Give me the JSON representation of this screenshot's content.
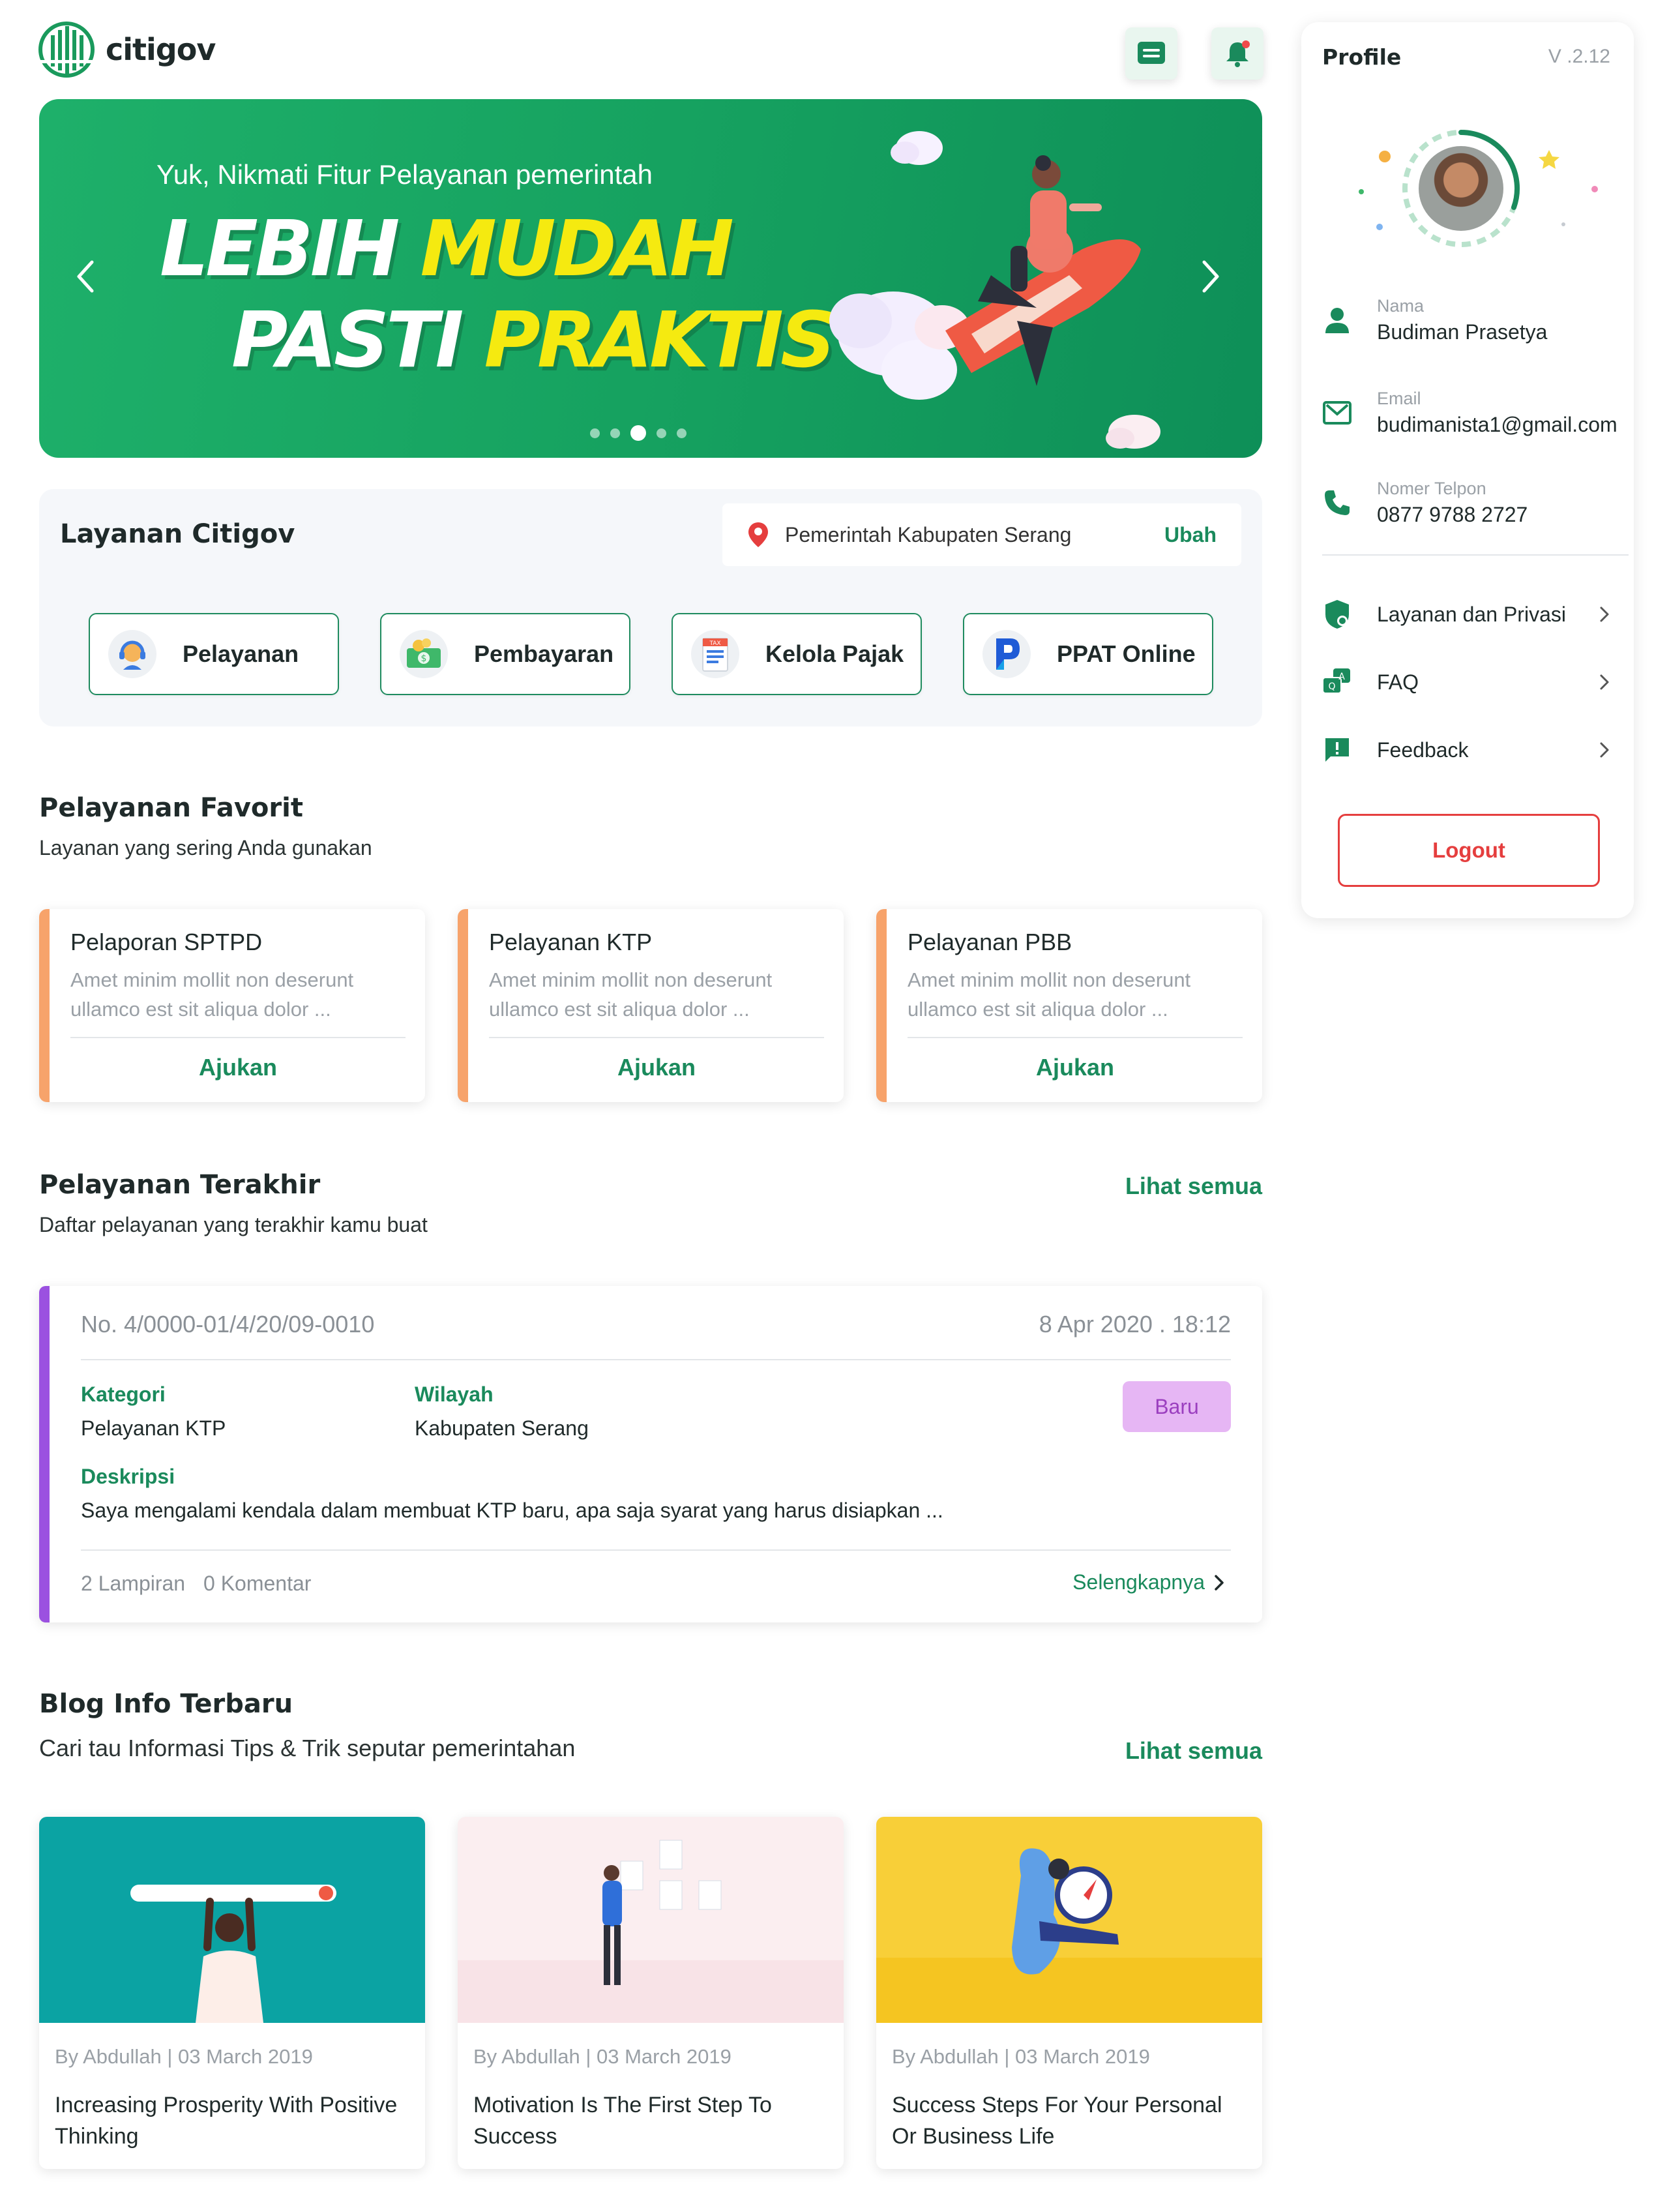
{
  "brand": {
    "name": "citigov",
    "primary": "#1a8a5c",
    "accent": "#f5ea10"
  },
  "header": {
    "message_icon": "message-icon",
    "notification_icon": "bell-icon"
  },
  "banner": {
    "subtitle": "Yuk, Nikmati Fitur Pelayanan pemerintah",
    "line1_white": "LEBIH ",
    "line1_yellow": "MUDAH",
    "line2_white": "PASTI ",
    "line2_yellow": "PRAKTIS",
    "slide_count": 5,
    "active_slide": 3
  },
  "layanan": {
    "title": "Layanan Citigov",
    "location": "Pemerintah Kabupaten Serang",
    "change_label": "Ubah",
    "services": [
      {
        "label": "Pelayanan",
        "icon": "support-agent-icon"
      },
      {
        "label": "Pembayaran",
        "icon": "money-icon"
      },
      {
        "label": "Kelola Pajak",
        "icon": "tax-icon"
      },
      {
        "label": "PPAT Online",
        "icon": "ppat-logo-icon"
      }
    ]
  },
  "favorit": {
    "title": "Pelayanan Favorit",
    "subtitle": "Layanan yang sering Anda gunakan",
    "cards": [
      {
        "title": "Pelaporan SPTPD",
        "desc": "Amet minim mollit non deserunt ullamco est sit aliqua dolor ...",
        "action": "Ajukan"
      },
      {
        "title": "Pelayanan KTP",
        "desc": "Amet minim mollit non deserunt ullamco est sit aliqua dolor ...",
        "action": "Ajukan"
      },
      {
        "title": "Pelayanan PBB",
        "desc": "Amet minim mollit non deserunt ullamco est sit aliqua dolor ...",
        "action": "Ajukan"
      }
    ]
  },
  "terakhir": {
    "title": "Pelayanan Terakhir",
    "subtitle": "Daftar pelayanan yang terakhir kamu buat",
    "see_all": "Lihat semua",
    "ticket": {
      "number": "No. 4/0000-01/4/20/09-0010",
      "date": "8 Apr 2020 . 18:12",
      "kategori_label": "Kategori",
      "kategori": "Pelayanan KTP",
      "wilayah_label": "Wilayah",
      "wilayah": "Kabupaten Serang",
      "status": "Baru",
      "deskripsi_label": "Deskripsi",
      "deskripsi": "Saya mengalami kendala dalam membuat KTP baru, apa saja syarat yang harus disiapkan ...",
      "lampiran": "2 Lampiran",
      "komentar": "0 Komentar",
      "more": "Selengkapnya"
    }
  },
  "blog": {
    "title": "Blog Info Terbaru",
    "subtitle": "Cari tau Informasi Tips & Trik seputar pemerintahan",
    "see_all": "Lihat semua",
    "posts": [
      {
        "meta": "By Abdullah |  03 March 2019",
        "title": "Increasing Prosperity With Positive Thinking"
      },
      {
        "meta": "By Abdullah | 03 March 2019",
        "title": "Motivation Is The First Step To Success"
      },
      {
        "meta": "By Abdullah | 03 March 2019",
        "title": "Success Steps For Your Personal Or Business Life"
      }
    ]
  },
  "profile": {
    "title": "Profile",
    "version": "V .2.12",
    "fields": [
      {
        "label": "Nama",
        "value": "Budiman Prasetya",
        "icon": "user-icon"
      },
      {
        "label": "Email",
        "value": "budimanista1@gmail.com",
        "icon": "mail-icon"
      },
      {
        "label": "Nomer Telpon",
        "value": "0877 9788 2727",
        "icon": "phone-icon"
      }
    ],
    "menu": [
      {
        "label": "Layanan dan Privasi",
        "icon": "shield-icon"
      },
      {
        "label": "FAQ",
        "icon": "faq-icon"
      },
      {
        "label": "Feedback",
        "icon": "feedback-icon"
      }
    ],
    "logout": "Logout"
  }
}
